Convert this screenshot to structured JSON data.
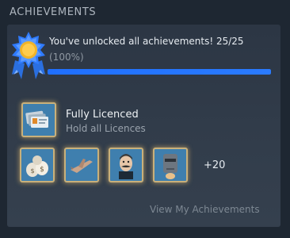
{
  "section": {
    "title": "ACHIEVEMENTS"
  },
  "summary": {
    "text": "You've unlocked all achievements! 25/25",
    "percent_text": "(100%)",
    "progress": 1.0
  },
  "featured": {
    "title": "Fully Licenced",
    "description": "Hold all Licences",
    "icon": "licence-cards-icon"
  },
  "achievement_icons": [
    "money-bags-icon",
    "airplane-icon",
    "mustache-man-icon",
    "robot-head-icon"
  ],
  "more_count": "+20",
  "link": {
    "label": "View My Achievements"
  },
  "colors": {
    "background": "#1e2732",
    "panel": "#2f3a48",
    "progress_fill": "#2a7bff",
    "tile_border": "#c9b07a",
    "tile_bg": "#3f7fae"
  }
}
